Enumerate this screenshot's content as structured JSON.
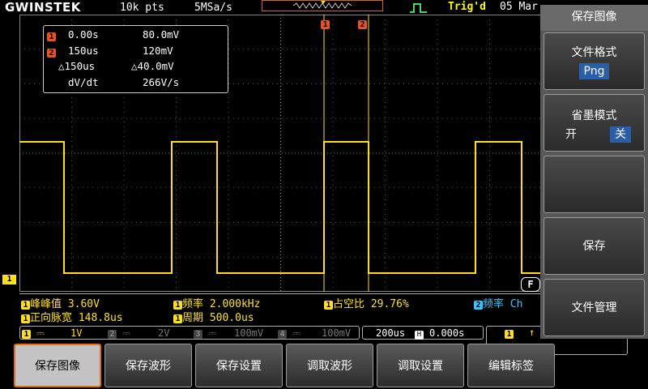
{
  "header": {
    "logo": "GWINSTEK",
    "record_length": "10k pts",
    "sample_rate": "5MSa/s",
    "trigger_state": "Trig'd",
    "date": "05 Mar"
  },
  "cursor_readout": {
    "c1_time": "0.00s",
    "c1_volt": "80.0mV",
    "c2_time": "150us",
    "c2_volt": "120mV",
    "delta_time": "△150us",
    "delta_volt": "△40.0mV",
    "dvdt_label": "dV/dt",
    "dvdt_value": "266V/s"
  },
  "cursor_markers": {
    "c1": "1",
    "c2": "2"
  },
  "measurements": {
    "pk_pk": "峰峰值 3.60V",
    "frequency": "频率 2.000kHz",
    "duty": "占空比 29.76%",
    "ch2_freq": "频率 Ch",
    "pos_width": "正向脉宽 148.8us",
    "period": "周期 500.0us"
  },
  "status": {
    "ch1_scale": "1V",
    "ch2_scale": "2V",
    "ch3_scale": "100mV",
    "ch4_scale": "100mV",
    "timebase": "200us",
    "position": "0.000s"
  },
  "channel_numbers": [
    "1",
    "2",
    "3",
    "4"
  ],
  "ch1_marker": "1",
  "f_marker": "F",
  "menu": {
    "title": "保存图像",
    "format_label": "文件格式",
    "format_value": "Png",
    "ink_label": "省墨模式",
    "ink_on": "开",
    "ink_off": "关",
    "save": "保存",
    "file_manager": "文件管理"
  },
  "softkeys": [
    "保存图像",
    "保存波形",
    "保存设置",
    "调取波形",
    "调取设置",
    "编辑标签"
  ],
  "colors": {
    "ch1": "#ffe01a",
    "ch2": "#33c8ff",
    "cursor": "#e8531f",
    "accent": "#2a5ea8"
  }
}
